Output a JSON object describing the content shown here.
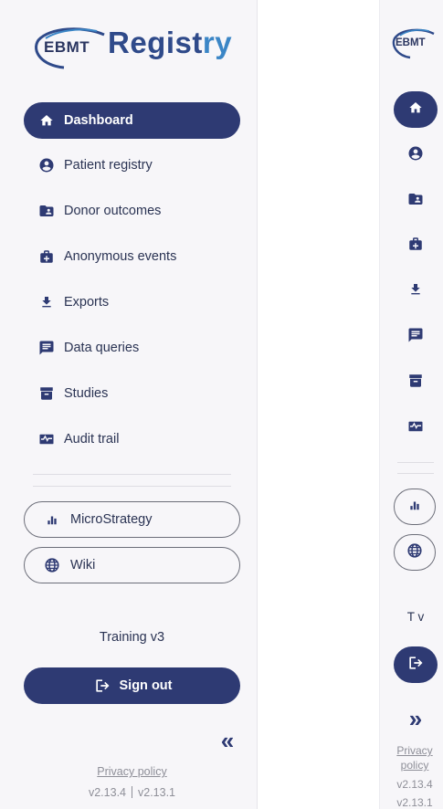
{
  "brand": {
    "logo_prefix": "EBMT",
    "logo_word_main": "Regist",
    "logo_word_accent": "ry"
  },
  "nav": {
    "items": [
      {
        "label": "Dashboard",
        "icon": "home-icon",
        "active": true
      },
      {
        "label": "Patient registry",
        "icon": "account-circle-icon",
        "active": false
      },
      {
        "label": "Donor outcomes",
        "icon": "folder-user-icon",
        "active": false
      },
      {
        "label": "Anonymous events",
        "icon": "medical-bag-icon",
        "active": false
      },
      {
        "label": "Exports",
        "icon": "download-icon",
        "active": false
      },
      {
        "label": "Data queries",
        "icon": "message-text-icon",
        "active": false
      },
      {
        "label": "Studies",
        "icon": "archive-icon",
        "active": false
      },
      {
        "label": "Audit trail",
        "icon": "pulse-monitor-icon",
        "active": false
      }
    ]
  },
  "links": {
    "microstrategy_label": "MicroStrategy",
    "wiki_label": "Wiki"
  },
  "footer": {
    "environment": "Training v3",
    "environment_short": "T v",
    "sign_out_label": "Sign out",
    "collapse_glyph": "«",
    "expand_glyph": "»",
    "privacy_label": "Privacy policy",
    "privacy_line1": "Privacy",
    "privacy_line2": "policy",
    "version_frontend": "v2.13.4",
    "version_backend": "v2.13.1"
  },
  "colors": {
    "primary": "#2e3a73",
    "sidebar_bg": "#f7f6f9",
    "text": "#2a3353",
    "muted": "#8e8f98",
    "logo_blue": "#2f4a8a",
    "logo_accent": "#3b86c6"
  }
}
